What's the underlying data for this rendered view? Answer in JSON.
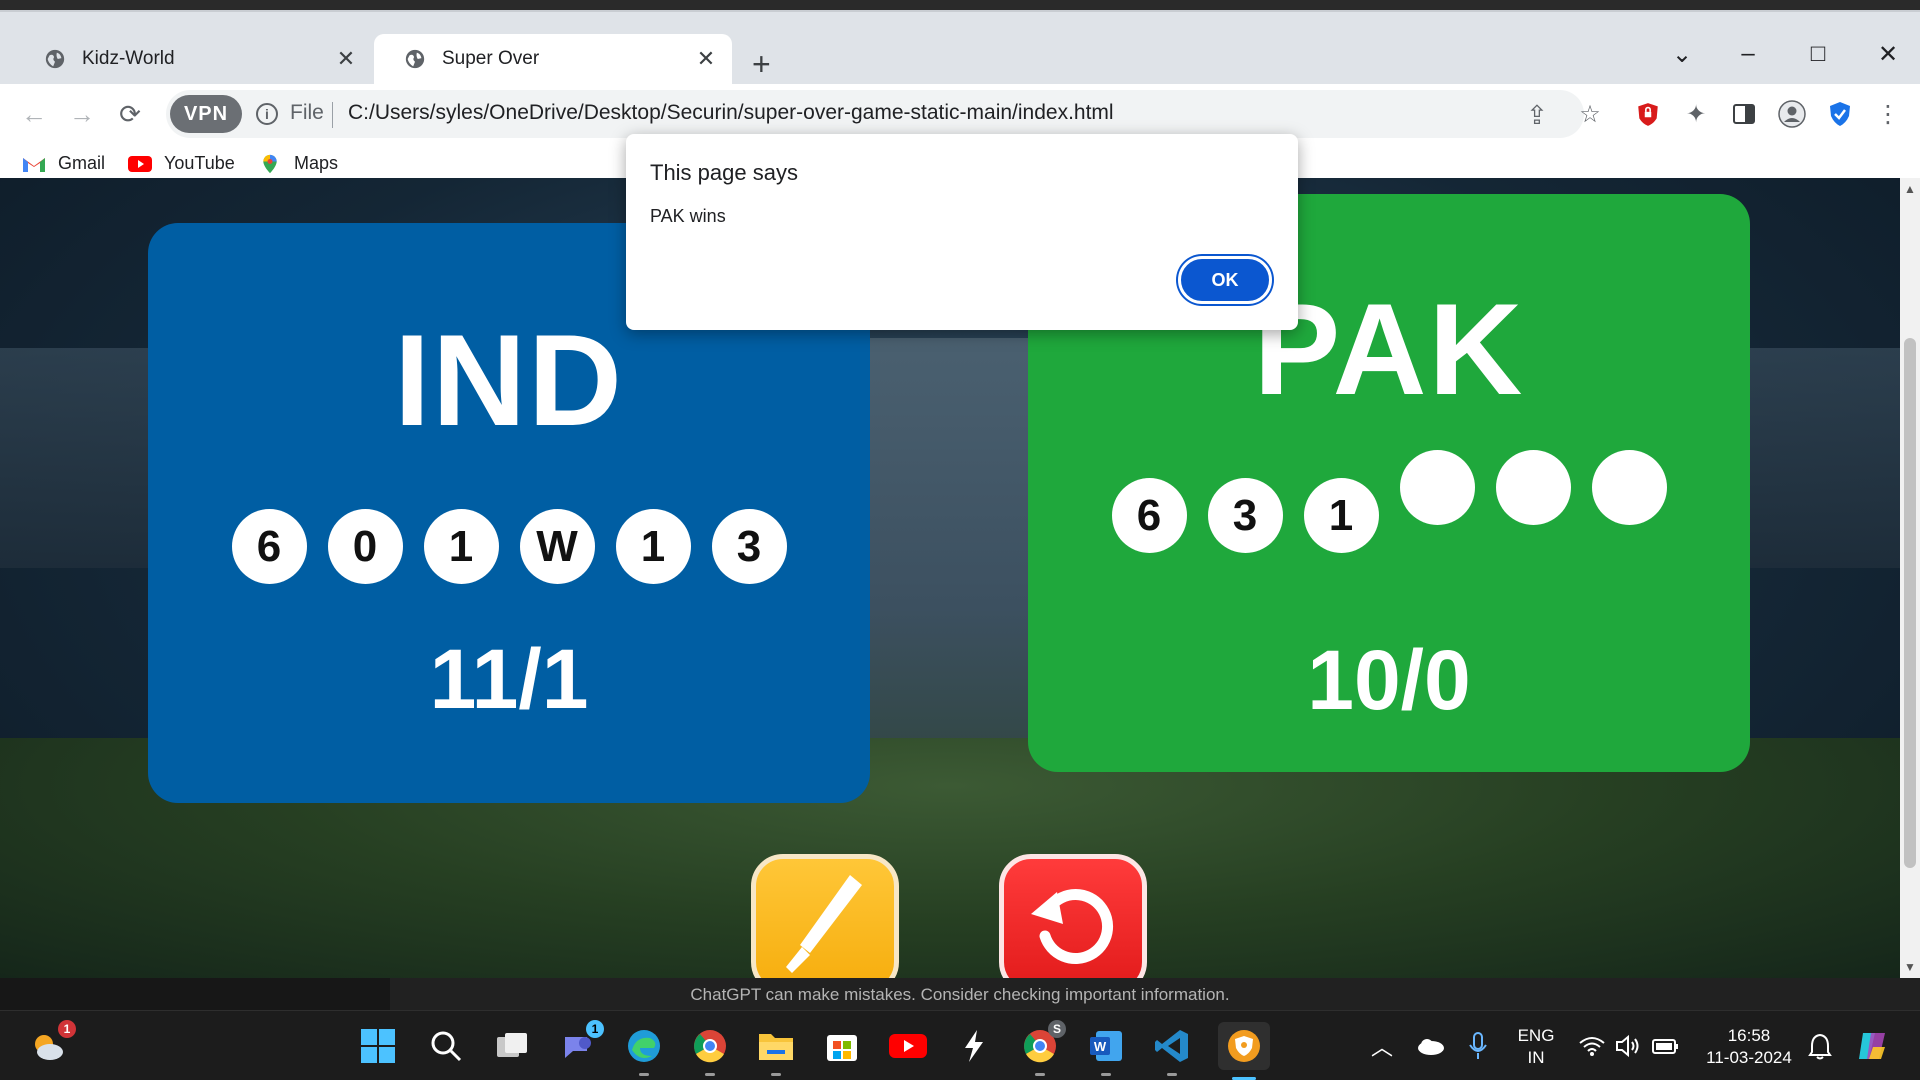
{
  "browser": {
    "tabs": [
      {
        "title": "Kidz-World",
        "active": false
      },
      {
        "title": "Super Over",
        "active": true
      }
    ],
    "new_tab": "+",
    "window_controls": {
      "chevron": "⌄",
      "minimize": "–",
      "maximize": "□",
      "close": "✕"
    },
    "address": {
      "vpn_label": "VPN",
      "scheme_label": "File",
      "url": "C:/Users/syles/OneDrive/Desktop/Securin/super-over-game-static-main/index.html"
    },
    "bookmarks": [
      {
        "label": "Gmail",
        "icon": "gmail-icon"
      },
      {
        "label": "YouTube",
        "icon": "youtube-icon"
      },
      {
        "label": "Maps",
        "icon": "maps-icon"
      }
    ]
  },
  "game": {
    "team1": {
      "name": "IND",
      "balls": [
        "6",
        "0",
        "1",
        "W",
        "1",
        "3"
      ],
      "score": "11/1",
      "color": "#005ea3"
    },
    "team2": {
      "name": "PAK",
      "balls": [
        "6",
        "3",
        "1",
        "",
        "",
        ""
      ],
      "score": "10/0",
      "color": "#1fa83c"
    },
    "buttons": {
      "strike": "bat-icon",
      "reset": "restart-icon"
    }
  },
  "dialog": {
    "title": "This page says",
    "message": "PAK wins",
    "ok_label": "OK"
  },
  "behind_window": {
    "notice": "ChatGPT can make mistakes. Consider checking important information."
  },
  "taskbar": {
    "weather_badge": "1",
    "teams_badge": "1",
    "chrome_profile_badge": "S",
    "language": {
      "line1": "ENG",
      "line2": "IN"
    },
    "clock": {
      "time": "16:58",
      "date": "11-03-2024"
    }
  }
}
